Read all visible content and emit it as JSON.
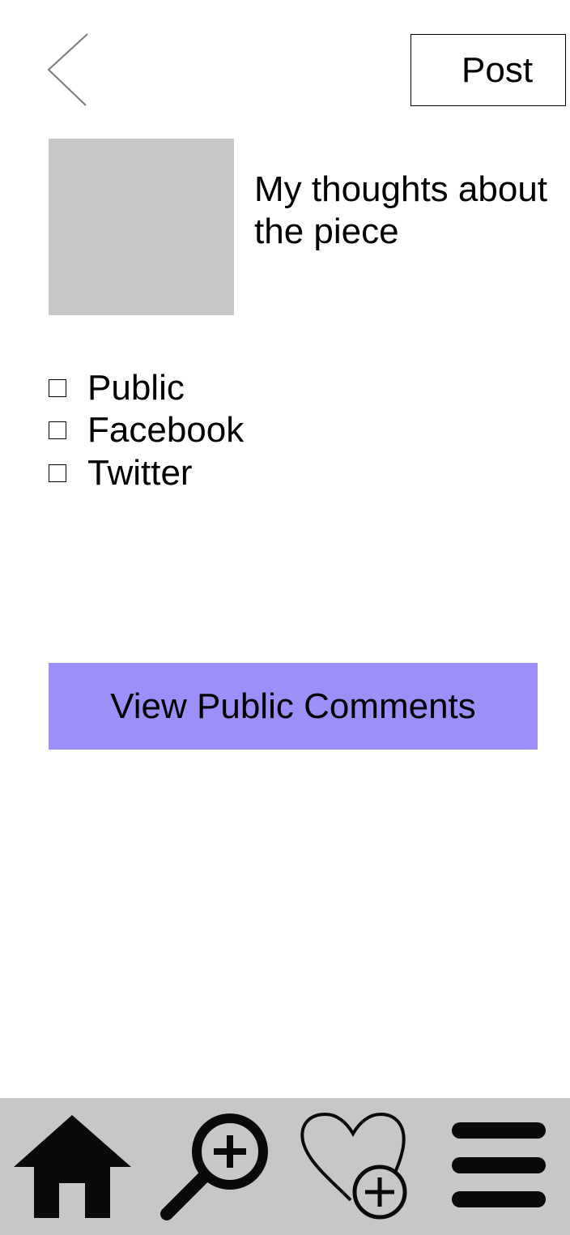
{
  "header": {
    "back_icon": "chevron-left-icon",
    "post_label": "Post"
  },
  "post": {
    "image_placeholder_color": "#c7c7c7",
    "text": "My thoughts about\nthe piece"
  },
  "share_options": [
    {
      "label": "Public",
      "checked": false
    },
    {
      "label": "Facebook",
      "checked": false
    },
    {
      "label": "Twitter",
      "checked": false
    }
  ],
  "view_comments": {
    "label": "View Public Comments",
    "color": "#9d8ff9"
  },
  "bottom_nav": {
    "background": "#c7c7c7",
    "items": [
      {
        "icon": "home-icon"
      },
      {
        "icon": "zoom-in-icon"
      },
      {
        "icon": "heart-add-icon"
      },
      {
        "icon": "menu-icon"
      }
    ]
  }
}
